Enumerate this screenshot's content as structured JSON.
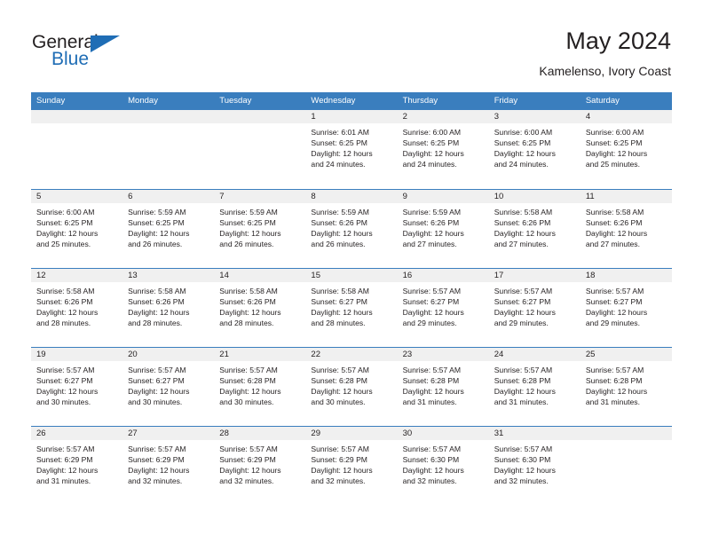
{
  "brand": {
    "name_top": "General",
    "name_bottom": "Blue",
    "accent_color": "#1f6db5"
  },
  "header": {
    "title": "May 2024",
    "subtitle": "Kamelenso, Ivory Coast"
  },
  "theme": {
    "header_row_bg": "#3a7ebe",
    "day_band_bg": "#f0f0f0",
    "text_color": "#231f20"
  },
  "weekdays": [
    "Sunday",
    "Monday",
    "Tuesday",
    "Wednesday",
    "Thursday",
    "Friday",
    "Saturday"
  ],
  "weeks": [
    [
      {
        "day": "",
        "empty": true
      },
      {
        "day": "",
        "empty": true
      },
      {
        "day": "",
        "empty": true
      },
      {
        "day": "1",
        "sunrise": "Sunrise: 6:01 AM",
        "sunset": "Sunset: 6:25 PM",
        "daylight1": "Daylight: 12 hours",
        "daylight2": "and 24 minutes."
      },
      {
        "day": "2",
        "sunrise": "Sunrise: 6:00 AM",
        "sunset": "Sunset: 6:25 PM",
        "daylight1": "Daylight: 12 hours",
        "daylight2": "and 24 minutes."
      },
      {
        "day": "3",
        "sunrise": "Sunrise: 6:00 AM",
        "sunset": "Sunset: 6:25 PM",
        "daylight1": "Daylight: 12 hours",
        "daylight2": "and 24 minutes."
      },
      {
        "day": "4",
        "sunrise": "Sunrise: 6:00 AM",
        "sunset": "Sunset: 6:25 PM",
        "daylight1": "Daylight: 12 hours",
        "daylight2": "and 25 minutes."
      }
    ],
    [
      {
        "day": "5",
        "sunrise": "Sunrise: 6:00 AM",
        "sunset": "Sunset: 6:25 PM",
        "daylight1": "Daylight: 12 hours",
        "daylight2": "and 25 minutes."
      },
      {
        "day": "6",
        "sunrise": "Sunrise: 5:59 AM",
        "sunset": "Sunset: 6:25 PM",
        "daylight1": "Daylight: 12 hours",
        "daylight2": "and 26 minutes."
      },
      {
        "day": "7",
        "sunrise": "Sunrise: 5:59 AM",
        "sunset": "Sunset: 6:25 PM",
        "daylight1": "Daylight: 12 hours",
        "daylight2": "and 26 minutes."
      },
      {
        "day": "8",
        "sunrise": "Sunrise: 5:59 AM",
        "sunset": "Sunset: 6:26 PM",
        "daylight1": "Daylight: 12 hours",
        "daylight2": "and 26 minutes."
      },
      {
        "day": "9",
        "sunrise": "Sunrise: 5:59 AM",
        "sunset": "Sunset: 6:26 PM",
        "daylight1": "Daylight: 12 hours",
        "daylight2": "and 27 minutes."
      },
      {
        "day": "10",
        "sunrise": "Sunrise: 5:58 AM",
        "sunset": "Sunset: 6:26 PM",
        "daylight1": "Daylight: 12 hours",
        "daylight2": "and 27 minutes."
      },
      {
        "day": "11",
        "sunrise": "Sunrise: 5:58 AM",
        "sunset": "Sunset: 6:26 PM",
        "daylight1": "Daylight: 12 hours",
        "daylight2": "and 27 minutes."
      }
    ],
    [
      {
        "day": "12",
        "sunrise": "Sunrise: 5:58 AM",
        "sunset": "Sunset: 6:26 PM",
        "daylight1": "Daylight: 12 hours",
        "daylight2": "and 28 minutes."
      },
      {
        "day": "13",
        "sunrise": "Sunrise: 5:58 AM",
        "sunset": "Sunset: 6:26 PM",
        "daylight1": "Daylight: 12 hours",
        "daylight2": "and 28 minutes."
      },
      {
        "day": "14",
        "sunrise": "Sunrise: 5:58 AM",
        "sunset": "Sunset: 6:26 PM",
        "daylight1": "Daylight: 12 hours",
        "daylight2": "and 28 minutes."
      },
      {
        "day": "15",
        "sunrise": "Sunrise: 5:58 AM",
        "sunset": "Sunset: 6:27 PM",
        "daylight1": "Daylight: 12 hours",
        "daylight2": "and 28 minutes."
      },
      {
        "day": "16",
        "sunrise": "Sunrise: 5:57 AM",
        "sunset": "Sunset: 6:27 PM",
        "daylight1": "Daylight: 12 hours",
        "daylight2": "and 29 minutes."
      },
      {
        "day": "17",
        "sunrise": "Sunrise: 5:57 AM",
        "sunset": "Sunset: 6:27 PM",
        "daylight1": "Daylight: 12 hours",
        "daylight2": "and 29 minutes."
      },
      {
        "day": "18",
        "sunrise": "Sunrise: 5:57 AM",
        "sunset": "Sunset: 6:27 PM",
        "daylight1": "Daylight: 12 hours",
        "daylight2": "and 29 minutes."
      }
    ],
    [
      {
        "day": "19",
        "sunrise": "Sunrise: 5:57 AM",
        "sunset": "Sunset: 6:27 PM",
        "daylight1": "Daylight: 12 hours",
        "daylight2": "and 30 minutes."
      },
      {
        "day": "20",
        "sunrise": "Sunrise: 5:57 AM",
        "sunset": "Sunset: 6:27 PM",
        "daylight1": "Daylight: 12 hours",
        "daylight2": "and 30 minutes."
      },
      {
        "day": "21",
        "sunrise": "Sunrise: 5:57 AM",
        "sunset": "Sunset: 6:28 PM",
        "daylight1": "Daylight: 12 hours",
        "daylight2": "and 30 minutes."
      },
      {
        "day": "22",
        "sunrise": "Sunrise: 5:57 AM",
        "sunset": "Sunset: 6:28 PM",
        "daylight1": "Daylight: 12 hours",
        "daylight2": "and 30 minutes."
      },
      {
        "day": "23",
        "sunrise": "Sunrise: 5:57 AM",
        "sunset": "Sunset: 6:28 PM",
        "daylight1": "Daylight: 12 hours",
        "daylight2": "and 31 minutes."
      },
      {
        "day": "24",
        "sunrise": "Sunrise: 5:57 AM",
        "sunset": "Sunset: 6:28 PM",
        "daylight1": "Daylight: 12 hours",
        "daylight2": "and 31 minutes."
      },
      {
        "day": "25",
        "sunrise": "Sunrise: 5:57 AM",
        "sunset": "Sunset: 6:28 PM",
        "daylight1": "Daylight: 12 hours",
        "daylight2": "and 31 minutes."
      }
    ],
    [
      {
        "day": "26",
        "sunrise": "Sunrise: 5:57 AM",
        "sunset": "Sunset: 6:29 PM",
        "daylight1": "Daylight: 12 hours",
        "daylight2": "and 31 minutes."
      },
      {
        "day": "27",
        "sunrise": "Sunrise: 5:57 AM",
        "sunset": "Sunset: 6:29 PM",
        "daylight1": "Daylight: 12 hours",
        "daylight2": "and 32 minutes."
      },
      {
        "day": "28",
        "sunrise": "Sunrise: 5:57 AM",
        "sunset": "Sunset: 6:29 PM",
        "daylight1": "Daylight: 12 hours",
        "daylight2": "and 32 minutes."
      },
      {
        "day": "29",
        "sunrise": "Sunrise: 5:57 AM",
        "sunset": "Sunset: 6:29 PM",
        "daylight1": "Daylight: 12 hours",
        "daylight2": "and 32 minutes."
      },
      {
        "day": "30",
        "sunrise": "Sunrise: 5:57 AM",
        "sunset": "Sunset: 6:30 PM",
        "daylight1": "Daylight: 12 hours",
        "daylight2": "and 32 minutes."
      },
      {
        "day": "31",
        "sunrise": "Sunrise: 5:57 AM",
        "sunset": "Sunset: 6:30 PM",
        "daylight1": "Daylight: 12 hours",
        "daylight2": "and 32 minutes."
      },
      {
        "day": "",
        "empty": true
      }
    ]
  ]
}
